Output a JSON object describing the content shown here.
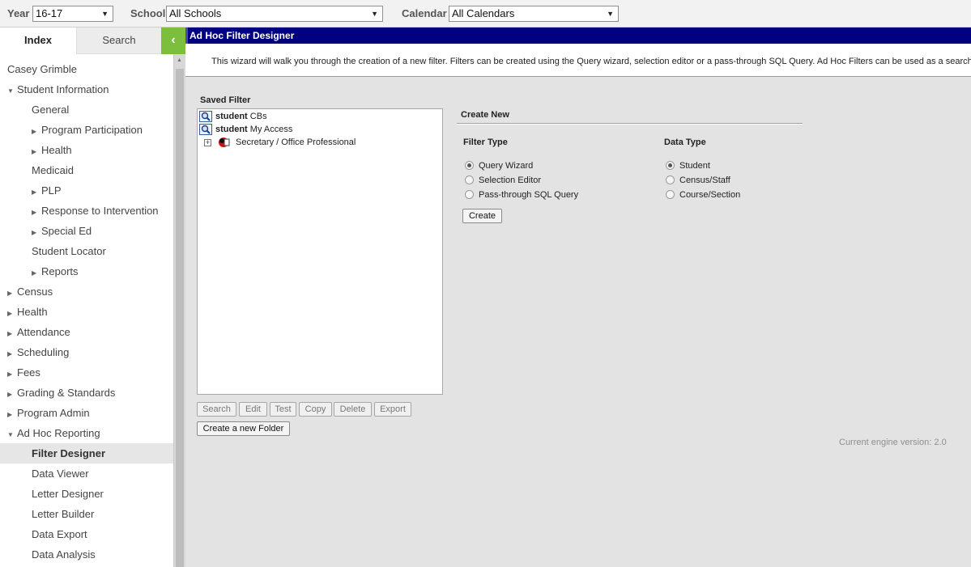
{
  "topbar": {
    "year_label": "Year",
    "year_value": "16-17",
    "school_label": "School",
    "school_value": "All Schools",
    "calendar_label": "Calendar",
    "calendar_value": "All Calendars"
  },
  "sidebar": {
    "tabs": [
      {
        "label": "Index"
      },
      {
        "label": "Search"
      }
    ],
    "collapse_glyph": "‹",
    "items": [
      {
        "label": "Casey Grimble"
      },
      {
        "label": "Student Information"
      },
      {
        "label": "General"
      },
      {
        "label": "Program Participation"
      },
      {
        "label": "Health"
      },
      {
        "label": "Medicaid"
      },
      {
        "label": "PLP"
      },
      {
        "label": "Response to Intervention"
      },
      {
        "label": "Special Ed"
      },
      {
        "label": "Student Locator"
      },
      {
        "label": "Reports"
      },
      {
        "label": "Census"
      },
      {
        "label": "Health"
      },
      {
        "label": "Attendance"
      },
      {
        "label": "Scheduling"
      },
      {
        "label": "Fees"
      },
      {
        "label": "Grading & Standards"
      },
      {
        "label": "Program Admin"
      },
      {
        "label": "Ad Hoc Reporting"
      },
      {
        "label": "Filter Designer"
      },
      {
        "label": "Data Viewer"
      },
      {
        "label": "Letter Designer"
      },
      {
        "label": "Letter Builder"
      },
      {
        "label": "Data Export"
      },
      {
        "label": "Data Analysis"
      }
    ]
  },
  "main": {
    "header_title": "Ad Hoc Filter Designer",
    "intro_text": "This wizard will walk you through the creation of a new filter. Filters can be created using the Query wizard, selection editor or a pass-through SQL Query. Ad Hoc Filters can be used as a search, or a",
    "saved_filter": {
      "title": "Saved Filter",
      "items": [
        {
          "type": "student",
          "name": "CBs"
        },
        {
          "type": "student",
          "name": "My Access"
        }
      ],
      "folder": "Secretary / Office Professional"
    },
    "buttons": {
      "search": "Search",
      "edit": "Edit",
      "test": "Test",
      "copy": "Copy",
      "delete": "Delete",
      "export": "Export",
      "new_folder": "Create a new Folder",
      "create": "Create"
    },
    "create_new": {
      "title": "Create New",
      "filter_type_title": "Filter Type",
      "filter_types": [
        {
          "label": "Query Wizard",
          "selected": true
        },
        {
          "label": "Selection Editor",
          "selected": false
        },
        {
          "label": "Pass-through SQL Query",
          "selected": false
        }
      ],
      "data_type_title": "Data Type",
      "data_types": [
        {
          "label": "Student",
          "selected": true
        },
        {
          "label": "Census/Staff",
          "selected": false
        },
        {
          "label": "Course/Section",
          "selected": false
        }
      ]
    },
    "engine_version": "Current engine version: 2.0"
  },
  "colors": {
    "header_bg": "#000080",
    "collapse_button": "#7cbf3c",
    "main_bg": "#e3e3e3"
  }
}
